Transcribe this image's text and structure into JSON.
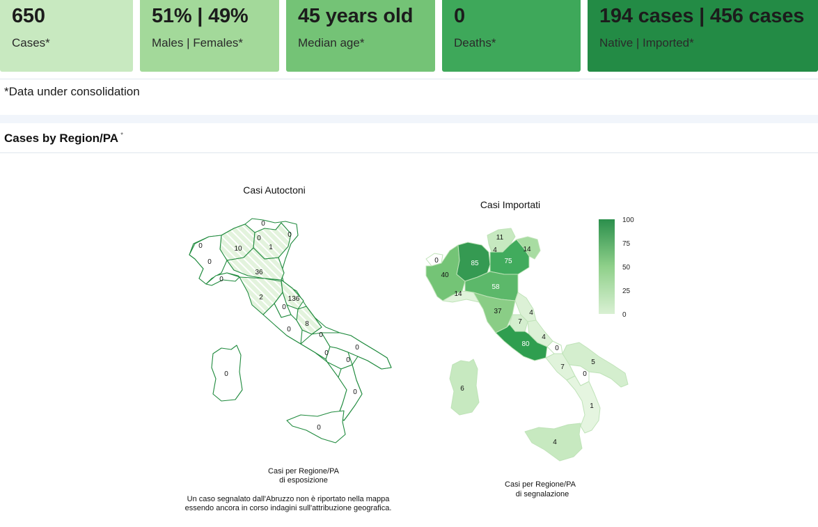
{
  "kpis": [
    {
      "value": "650",
      "label": "Cases*"
    },
    {
      "value": "51% | 49%",
      "label": "Males | Females*"
    },
    {
      "value": "45 years old",
      "label": "Median age*"
    },
    {
      "value": "0",
      "label": "Deaths*"
    },
    {
      "value": "194 cases | 456 cases",
      "label": "Native | Imported*"
    }
  ],
  "note": "*Data under consolidation",
  "section": {
    "title": "Cases by Region/PA",
    "marker": "*"
  },
  "colors": {
    "low": "#e5f5e0",
    "mid": "#74c476",
    "high": "#238b45",
    "outline": "#1f8a3d"
  },
  "chart_data": [
    {
      "type": "heatmap",
      "title": "Casi Autoctoni",
      "caption": [
        "Casi per Regione/PA",
        "di esposizione"
      ],
      "footnote": [
        "Un caso segnalato dall'Abruzzo non è riportato nella mappa",
        "essendo ancora in corso indagini sull'attribuzione geografica."
      ],
      "labels": [
        "0",
        "0",
        "10",
        "0",
        "1",
        "0",
        "0",
        "36",
        "0",
        "2",
        "136",
        "0",
        "0",
        "8",
        "0",
        "0",
        "0",
        "0",
        "0",
        "0",
        "0"
      ],
      "hatched_regions_note": ""
    },
    {
      "type": "heatmap",
      "title": "Casi Importati",
      "caption": [
        "Casi per Regione/PA",
        "di segnalazione"
      ],
      "labels": [
        "11",
        "4",
        "14",
        "0",
        "85",
        "75",
        "40",
        "58",
        "14",
        "4",
        "37",
        "7",
        "4",
        "80",
        "0",
        "7",
        "5",
        "0",
        "1",
        "4",
        "6"
      ],
      "legend": {
        "ticks": [
          "100",
          "75",
          "50",
          "25",
          "0"
        ],
        "min": 0,
        "max": 100
      }
    }
  ]
}
